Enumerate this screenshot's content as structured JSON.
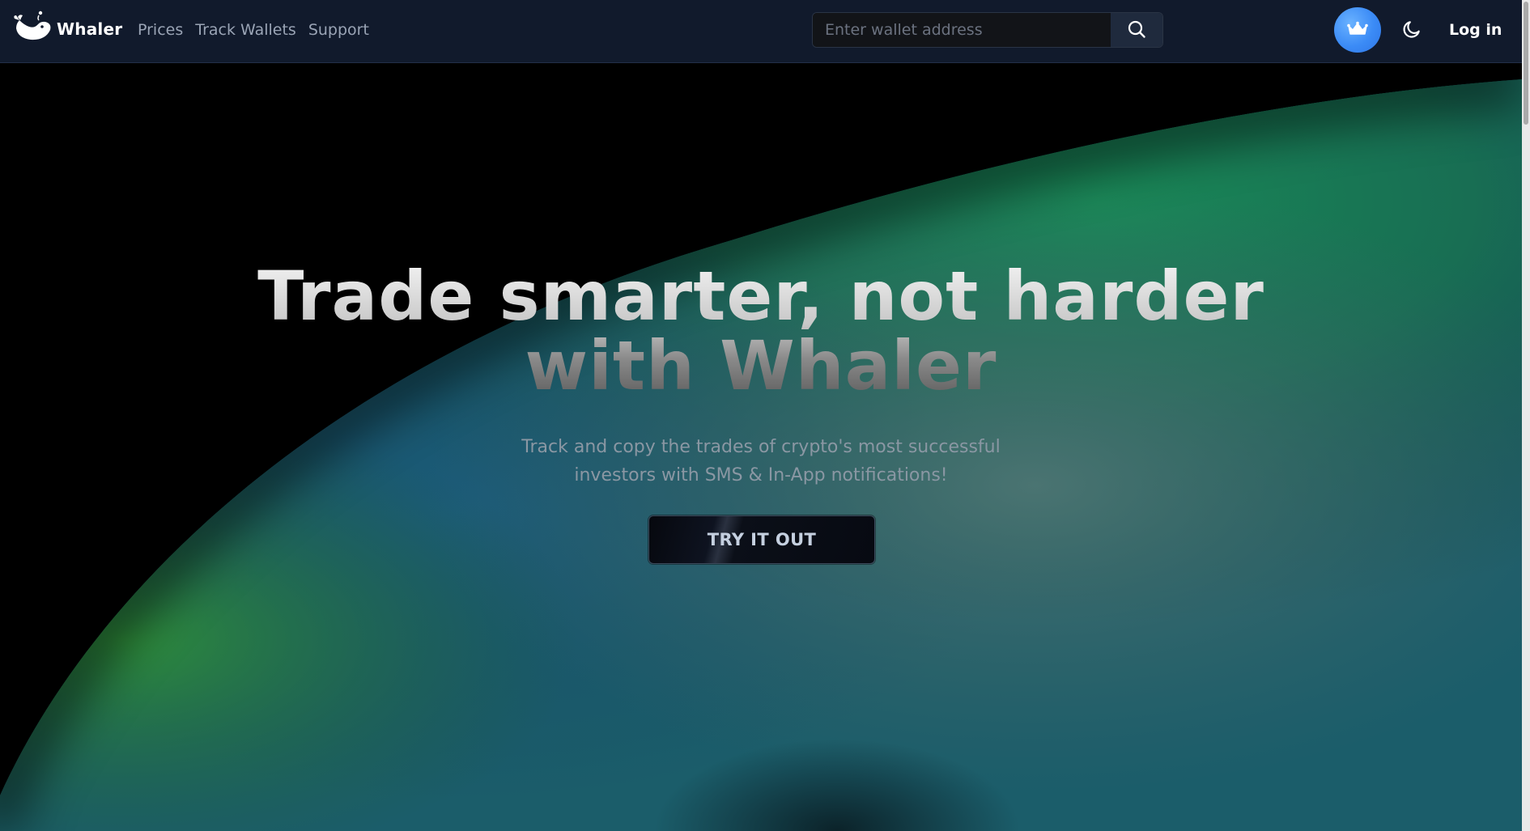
{
  "brand": {
    "name": "Whaler"
  },
  "nav": {
    "items": [
      {
        "label": "Prices"
      },
      {
        "label": "Track Wallets"
      },
      {
        "label": "Support"
      }
    ]
  },
  "search": {
    "placeholder": "Enter wallet address",
    "value": ""
  },
  "header": {
    "login_label": "Log in"
  },
  "icons": {
    "logo": "whale-icon",
    "search": "search-icon",
    "premium": "crown-icon",
    "theme": "moon-icon"
  },
  "hero": {
    "title_line1": "Trade smarter, not harder",
    "title_line2": "with Whaler",
    "subtitle_line1": "Track and copy the trades of crypto's most successful",
    "subtitle_line2": "investors with SMS & In-App notifications!",
    "cta_label": "TRY IT OUT"
  },
  "colors": {
    "header_bg": "#111a2c",
    "accent_blue": "#3b8bf6",
    "hero_green": "#1f8a5a",
    "hero_teal": "#1d6a78"
  }
}
